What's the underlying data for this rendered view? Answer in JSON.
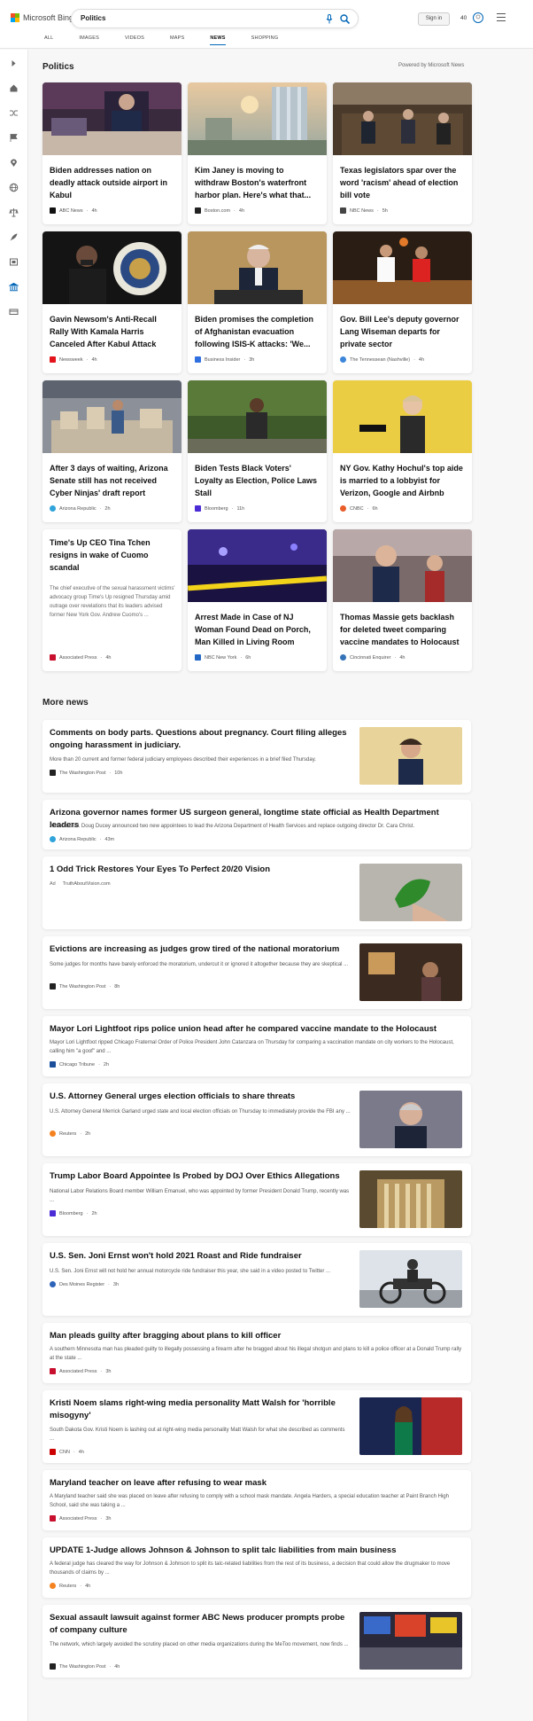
{
  "header": {
    "brand": "Microsoft Bing",
    "search_value": "Politics",
    "sign_in": "Sign in",
    "reward_count": "40",
    "tabs": [
      {
        "label": "ALL"
      },
      {
        "label": "IMAGES"
      },
      {
        "label": "VIDEOS"
      },
      {
        "label": "MAPS"
      },
      {
        "label": "NEWS",
        "active": true
      },
      {
        "label": "SHOPPING"
      }
    ]
  },
  "rail": {
    "icons": [
      "expand-icon",
      "home-icon",
      "shuffle-icon",
      "flag-icon",
      "location-icon",
      "globe-icon",
      "balance-icon",
      "rocket-icon",
      "film-icon",
      "bank-icon",
      "money-icon"
    ]
  },
  "section": {
    "title": "Politics",
    "powered_by": "Powered by Microsoft News"
  },
  "cards": [
    {
      "title": "Biden addresses nation on deadly attack outside airport in Kabul",
      "source": "ABC News",
      "age": "4h",
      "source_color": "#111111"
    },
    {
      "title": "Kim Janey is moving to withdraw Boston's waterfront harbor plan. Here's what that...",
      "source": "Boston.com",
      "age": "4h",
      "source_color": "#222222"
    },
    {
      "title": "Texas legislators spar over the word 'racism' ahead of election bill vote",
      "source": "NBC News",
      "age": "5h",
      "source_color": "#444444"
    },
    {
      "title": "Gavin Newsom's Anti-Recall Rally With Kamala Harris Canceled After Kabul Attack",
      "source": "Newsweek",
      "age": "4h",
      "source_color": "#e3131b"
    },
    {
      "title": "Biden promises the completion of Afghanistan evacuation following ISIS-K attacks: 'We...",
      "source": "Business Insider",
      "age": "3h",
      "source_color": "#2f6fe0"
    },
    {
      "title": "Gov. Bill Lee's deputy governor Lang Wiseman departs for private sector",
      "source": "The Tennessean (Nashville)",
      "age": "4h",
      "source_color": "#3d86d9"
    },
    {
      "title": "After 3 days of waiting, Arizona Senate still has not received Cyber Ninjas' draft report",
      "source": "Arizona Republic",
      "age": "2h",
      "source_color": "#2fa3da"
    },
    {
      "title": "Biden Tests Black Voters' Loyalty as Election, Police Laws Stall",
      "source": "Bloomberg",
      "age": "11h",
      "source_color": "#4a2bd6"
    },
    {
      "title": "NY Gov. Kathy Hochul's top aide is married to a lobbyist for Verizon, Google and Airbnb",
      "source": "CNBC",
      "age": "6h",
      "source_color": "#e85d2a"
    },
    {
      "title": "Time's Up CEO Tina Tchen resigns in wake of Cuomo scandal",
      "snippet": "The chief executive of the sexual harassment victims' advocacy group Time's Up resigned Thursday amid outrage over revelations that its leaders advised former New York Gov. Andrew Cuomo's ...",
      "source": "Associated Press",
      "age": "4h",
      "source_color": "#c8102e"
    },
    {
      "title": "Arrest Made in Case of NJ Woman Found Dead on Porch, Man Killed in Living Room",
      "source": "NBC New York",
      "age": "6h",
      "source_color": "#2368c4"
    },
    {
      "title": "Thomas Massie gets backlash for deleted tweet comparing vaccine mandates to Holocaust",
      "source": "Cincinnati Enquirer",
      "age": "4h",
      "source_color": "#3573b8"
    }
  ],
  "more_news": {
    "title": "More news",
    "items": [
      {
        "title": "Comments on body parts. Questions about pregnancy. Court filing alleges ongoing harassment in judiciary.",
        "snippet": "More than 20 current and former federal judiciary employees described their experiences in a brief filed Thursday.",
        "source": "The Washington Post",
        "age": "10h",
        "source_color": "#222222",
        "thumb": "woman-portrait"
      },
      {
        "title": "Arizona governor names former US surgeon general, longtime state official as Health Department leaders",
        "snippet": "Arizona Gov. Doug Ducey announced two new appointees to lead the Arizona Department of Health Services and replace outgoing director Dr. Cara Christ.",
        "source": "Arizona Republic",
        "age": "43m",
        "source_color": "#2fa3da"
      },
      {
        "title": "1 Odd Trick Restores Your Eyes To Perfect 20/20 Vision",
        "ad_label": "Ad",
        "source": "TruthAboutVision.com",
        "thumb": "leaf-hand"
      },
      {
        "title": "Evictions are increasing as judges grow tired of the national moratorium",
        "snippet": "Some judges for months have barely enforced the moratorium, undercut it or ignored it altogether because they are skeptical ...",
        "source": "The Washington Post",
        "age": "8h",
        "source_color": "#222222",
        "thumb": "dim-room"
      },
      {
        "title": "Mayor Lori Lightfoot rips police union head after he compared vaccine mandate to the Holocaust",
        "snippet": "Mayor Lori Lightfoot ripped Chicago Fraternal Order of Police President John Catanzara on Thursday for comparing a vaccination mandate on city workers to the Holocaust, calling him \"a goof\" and ...",
        "source": "Chicago Tribune",
        "age": "2h",
        "source_color": "#1b4f9c"
      },
      {
        "title": "U.S. Attorney General urges election officials to share threats",
        "snippet": "U.S. Attorney General Merrick Garland urged state and local election officials on Thursday to immediately provide the FBI any ...",
        "source": "Reuters",
        "age": "2h",
        "source_color": "#f58220",
        "thumb": "man-portrait"
      },
      {
        "title": "Trump Labor Board Appointee Is Probed by DOJ Over Ethics Allegations",
        "snippet": "National Labor Relations Board member William Emanuel, who was appointed by former President Donald Trump, recently was ...",
        "source": "Bloomberg",
        "age": "2h",
        "source_color": "#4a2bd6",
        "thumb": "building"
      },
      {
        "title": "U.S. Sen. Joni Ernst won't hold 2021 Roast and Ride fundraiser",
        "snippet": "U.S. Sen. Joni Ernst will not hold her annual motorcycle ride fundraiser this year, she said in a video posted to Twitter ...",
        "source": "Des Moines Register",
        "age": "3h",
        "source_color": "#2d63b8",
        "thumb": "motorcycle"
      },
      {
        "title": "Man pleads guilty after bragging about plans to kill officer",
        "snippet": "A southern Minnesota man has pleaded guilty to illegally possessing a firearm after he bragged about his illegal shotgun and plans to kill a police officer at a Donald Trump rally at the state ...",
        "source": "Associated Press",
        "age": "3h",
        "source_color": "#c8102e"
      },
      {
        "title": "Kristi Noem slams right-wing media personality Matt Walsh for 'horrible misogyny'",
        "snippet": "South Dakota Gov. Kristi Noem is lashing out at right-wing media personality Matt Walsh for what she described as comments ...",
        "source": "CNN",
        "age": "4h",
        "source_color": "#cc0000",
        "thumb": "woman-podium"
      },
      {
        "title": "Maryland teacher on leave after refusing to wear mask",
        "snippet": "A Maryland teacher said she was placed on leave after refusing to comply with a school mask mandate. Angela Harders, a special education teacher at Paint Branch High School, said she was taking a ...",
        "source": "Associated Press",
        "age": "3h",
        "source_color": "#c8102e"
      },
      {
        "title": "UPDATE 1-Judge allows Johnson & Johnson to split talc liabilities from main business",
        "snippet": "A federal judge has cleared the way for Johnson & Johnson to split its talc-related liabilities from the rest of its business, a decision that could allow the drugmaker to move thousands of claims by ...",
        "source": "Reuters",
        "age": "4h",
        "source_color": "#f58220"
      },
      {
        "title": "Sexual assault lawsuit against former ABC News producer prompts probe of company culture",
        "snippet": "The network, which largely avoided the scrutiny placed on other media organizations during the MeToo movement, now finds ...",
        "source": "The Washington Post",
        "age": "4h",
        "source_color": "#222222",
        "thumb": "times-square"
      }
    ]
  },
  "colors": {
    "accent": "#0067b8",
    "bing_red": "#f25022",
    "bing_green": "#7fba00",
    "bing_blue": "#00a4ef",
    "bing_yellow": "#ffb900"
  }
}
